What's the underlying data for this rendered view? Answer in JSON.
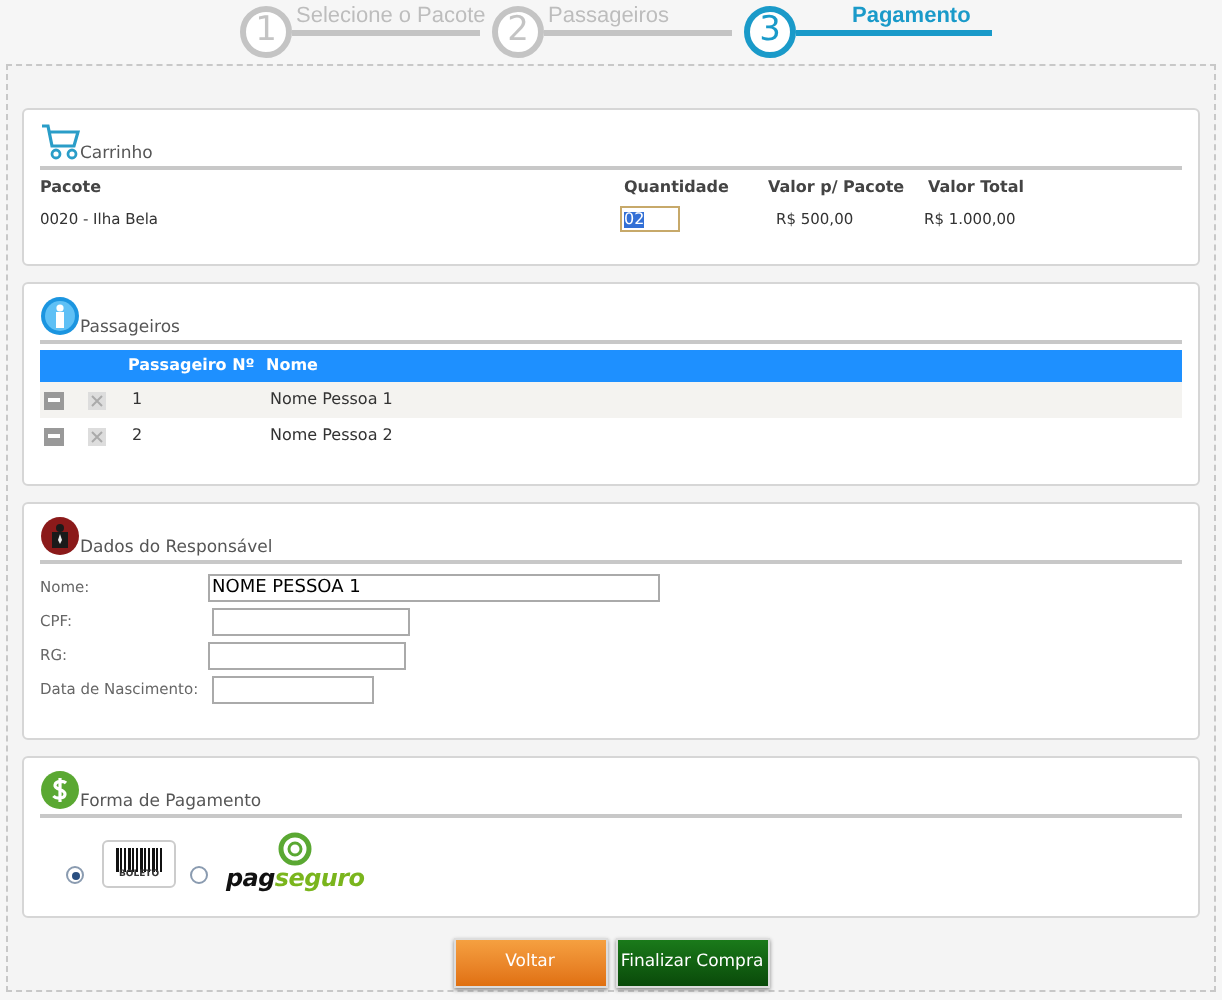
{
  "steps": [
    {
      "number": "1",
      "label": "Selecione o Pacote",
      "selected": false
    },
    {
      "number": "2",
      "label": "Passageiros",
      "selected": false
    },
    {
      "number": "3",
      "label": "Pagamento",
      "selected": true
    }
  ],
  "cart": {
    "title": "Carrinho",
    "columns": [
      "Pacote",
      "Quantidade",
      "Valor p/ Pacote",
      "Valor Total"
    ],
    "rows": [
      {
        "package": "0020 - Ilha Bela",
        "quantity": "02",
        "unit_price": "R$ 500,00",
        "total": "R$ 1.000,00"
      }
    ]
  },
  "passengers": {
    "title": "Passageiros",
    "columns": [
      "Passageiro Nº",
      "Nome"
    ],
    "rows": [
      {
        "number": "1",
        "name": "Nome Pessoa 1"
      },
      {
        "number": "2",
        "name": "Nome Pessoa 2"
      }
    ]
  },
  "responsible": {
    "title": "Dados do Responsável",
    "fields": [
      {
        "label": "Nome:",
        "value": "NOME PESSOA 1"
      },
      {
        "label": "CPF:"
      },
      {
        "label": "RG:"
      },
      {
        "label": "Data de Nascimento:"
      }
    ]
  },
  "payment": {
    "title": "Forma de Pagamento",
    "options": [
      {
        "kind": "boleto",
        "logo_text": "BOLETO",
        "selected": true
      },
      {
        "kind": "pagseguro",
        "logo_text": "pag",
        "logo_text_2": "seguro",
        "selected": false
      }
    ]
  },
  "buttons": [
    {
      "kind": "back",
      "label": "Voltar"
    },
    {
      "kind": "submit",
      "label": "Finalizar Compra"
    }
  ]
}
